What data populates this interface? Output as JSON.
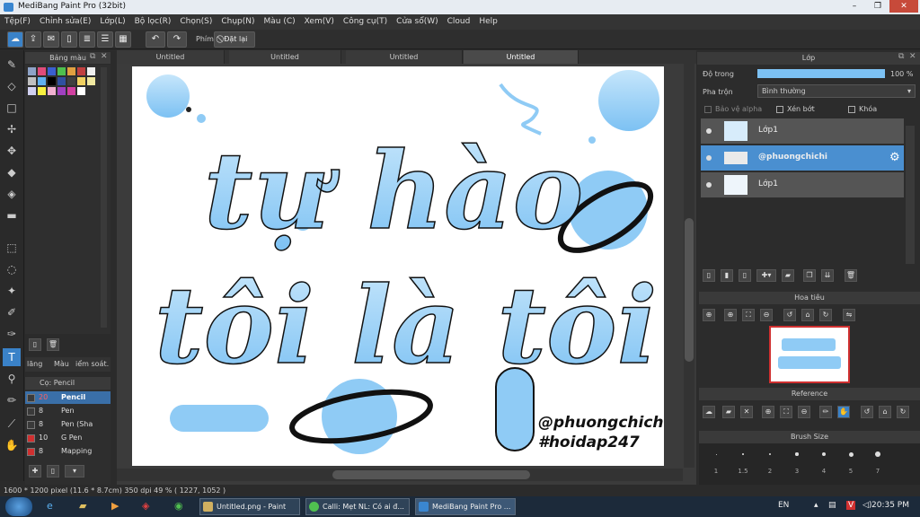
{
  "window": {
    "title": "MediBang Paint Pro (32bit)",
    "minimize": "–",
    "maximize": "❐",
    "close": "✕"
  },
  "menu": [
    "Tệp(F)",
    "Chỉnh sửa(E)",
    "Lớp(L)",
    "Bộ lọc(R)",
    "Chọn(S)",
    "Chụp(N)",
    "Màu (C)",
    "Xem(V)",
    "Công cụ(T)",
    "Cửa sổ(W)",
    "Cloud",
    "Help"
  ],
  "toolbar": {
    "phim_label": "Phím",
    "reset_label": "Đặt lại"
  },
  "palette": {
    "title": "Bảng màu",
    "tabs": [
      "lăng",
      "Màu",
      "iểm soát."
    ],
    "colors": [
      "#8ea3c7",
      "#e04b7a",
      "#3a5fd0",
      "#4ec04e",
      "#e0a040",
      "#c04040",
      "#f0f0f0",
      "#c0c0c0",
      "#60b0f0",
      "#000000",
      "#3050a0",
      "#404040",
      "#f0d060",
      "#f0e8a0",
      "#d0d0f0",
      "#f8f040",
      "#f0b0d0",
      "#a040c0",
      "#d040a0",
      "#ffffff"
    ]
  },
  "brush": {
    "title": "Cọ: Pencil",
    "items": [
      {
        "size": "20",
        "name": "Pencil",
        "color": "#3a3a3a"
      },
      {
        "size": "8",
        "name": "Pen",
        "color": "#3a3a3a"
      },
      {
        "size": "8",
        "name": "Pen (Sha",
        "color": "#3a3a3a"
      },
      {
        "size": "10",
        "name": "G Pen",
        "color": "#d03030"
      },
      {
        "size": "8",
        "name": "Mapping",
        "color": "#d03030"
      }
    ]
  },
  "tabs": [
    "Untitled",
    "Untitled",
    "Untitled",
    "Untitled"
  ],
  "artwork": {
    "line1": "tự hào",
    "line2": "tôi là tôi",
    "handle": "@phuongchichi",
    "tag": "#hoidap247",
    "fill": "#8fcbf5"
  },
  "layers": {
    "title": "Lớp",
    "opacity_label": "Độ trong",
    "opacity_value": "100 %",
    "opacity": 1.0,
    "blend_label": "Pha trộn",
    "blend_value": "Bình thường",
    "alpha_lock": "Bảo vệ alpha",
    "clip": "Xén bớt",
    "lock": "Khóa",
    "items": [
      "Lớp1",
      "@phuongchichi",
      "Lớp1"
    ]
  },
  "navigator": {
    "title": "Hoa tiêu"
  },
  "reference": {
    "title": "Reference"
  },
  "brushsize": {
    "title": "Brush Size",
    "sizes": [
      "1",
      "1.5",
      "2",
      "3",
      "4",
      "5",
      "7"
    ]
  },
  "status": {
    "text": "1600 * 1200 pixel  (11.6 * 8.7cm)  350 dpi  49 %  ( 1227, 1052 )"
  },
  "taskbar": {
    "items": [
      "Untitled.png - Paint",
      "Calli: Mẹt NL: Có ai đ...",
      "MediBang Paint Pro ..."
    ],
    "lang": "EN",
    "time": "20:35 PM"
  }
}
